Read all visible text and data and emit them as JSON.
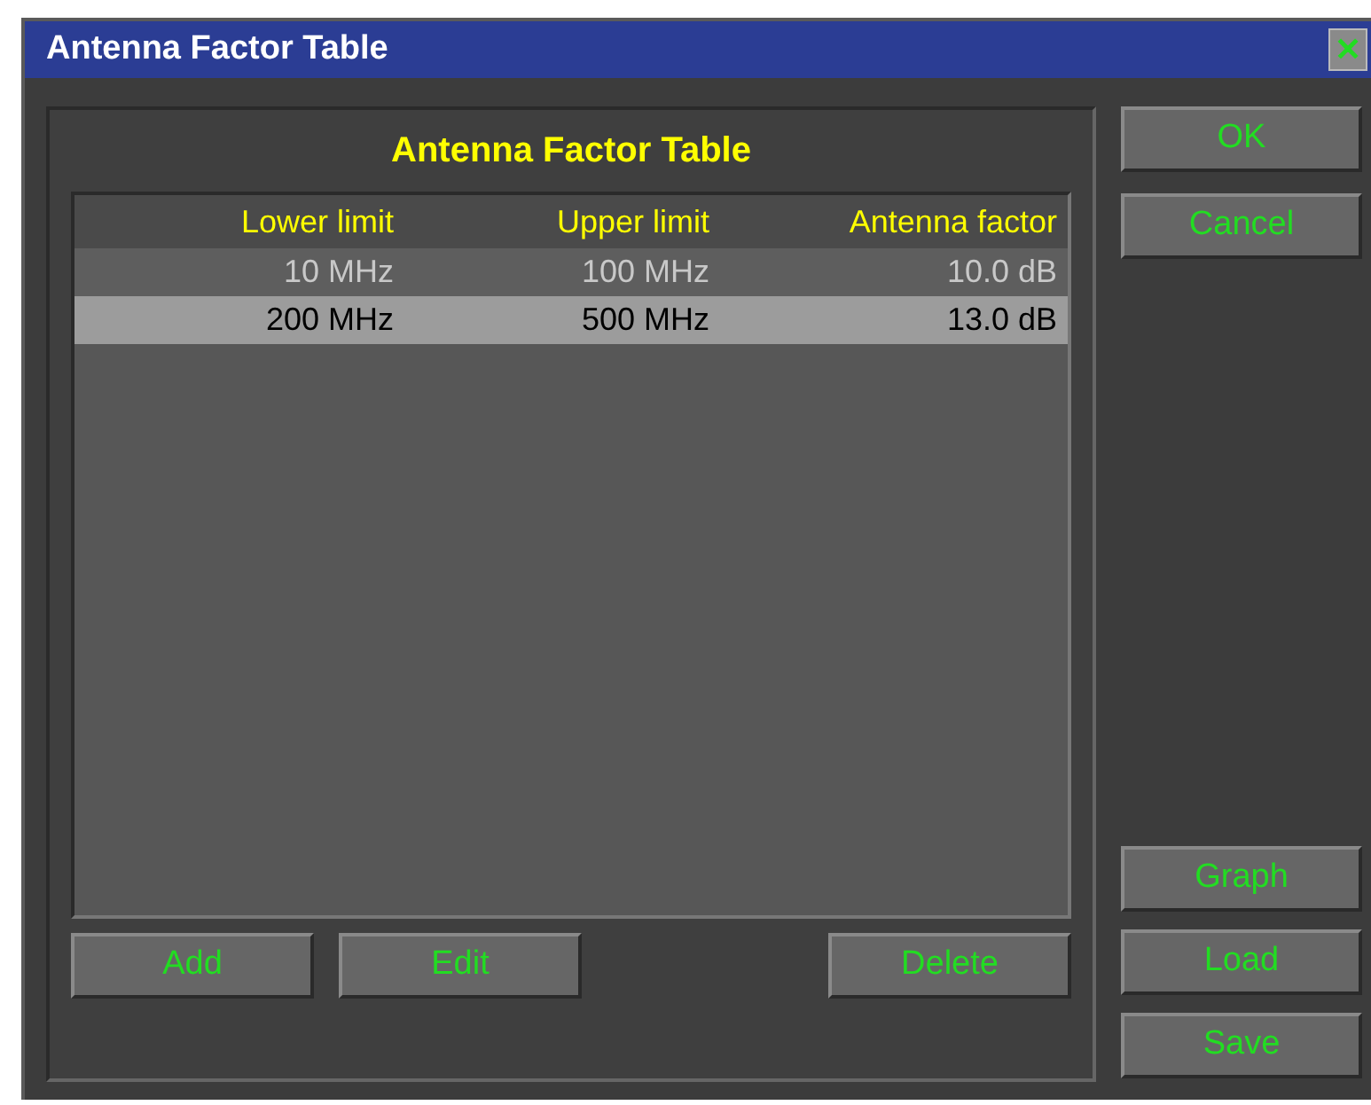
{
  "window": {
    "title": "Antenna Factor Table",
    "close": "✕"
  },
  "panel": {
    "title": "Antenna Factor Table"
  },
  "table": {
    "columns": [
      "Lower limit",
      "Upper limit",
      "Antenna factor"
    ],
    "rows": [
      {
        "cells": [
          "10 MHz",
          "100 MHz",
          "10.0 dB"
        ],
        "selected": false
      },
      {
        "cells": [
          "200 MHz",
          "500 MHz",
          "13.0 dB"
        ],
        "selected": true
      }
    ]
  },
  "table_buttons": [
    "Add",
    "Edit",
    "Delete"
  ],
  "side_buttons_top": [
    "OK",
    "Cancel"
  ],
  "side_buttons_bottom": [
    "Graph",
    "Load",
    "Save"
  ]
}
